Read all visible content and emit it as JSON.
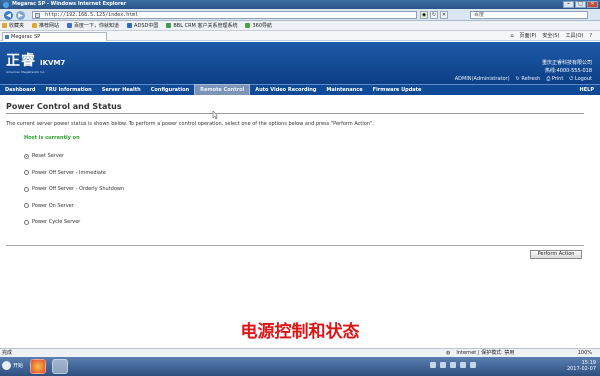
{
  "browser": {
    "title": "Megarac SP - Windows Internet Explorer",
    "url": "http://192.168.5.125/index.html",
    "search_placeholder": "百度",
    "favorites_label": "收藏夹",
    "favorites": [
      "推荐网站",
      "百度一下，你就知道",
      "ADSD中国",
      "BBL CRM 客户关系管理系统",
      "360导航"
    ],
    "tab_label": "Megarac SP",
    "commands": [
      "页面(P)",
      "安全(S)",
      "工具(O)"
    ],
    "status_left": "完成",
    "status_zone": "Internet | 保护模式: 禁用",
    "zoom": "100%"
  },
  "app": {
    "logo": "正睿",
    "logo_sub": "American Megatrends Inc.",
    "product": "IKVM7",
    "company_name": "重庆正睿科技有限公司",
    "hotline": "热线:4000-555-018",
    "user_label": "ADMIN(Administrator)",
    "refresh": "Refresh",
    "print": "Print",
    "logout": "Logout"
  },
  "menu": {
    "items": [
      "Dashboard",
      "FRU Information",
      "Server Health",
      "Configuration",
      "Remote Control",
      "Auto Video Recording",
      "Maintenance",
      "Firmware Update"
    ],
    "active_index": 4,
    "help": "HELP"
  },
  "page": {
    "title": "Power Control and Status",
    "description": "The current server power status is shown below. To perform a power control operation, select one of the options below and press \"Perform Action\".",
    "host_status": "Host is currently on",
    "options": [
      "Reset Server",
      "Power Off Server - Immediate",
      "Power Off Server - Orderly Shutdown",
      "Power On Server",
      "Power Cycle Server"
    ],
    "selected_option": 0,
    "perform_button": "Perform Action",
    "caption": "电源控制和状态"
  },
  "taskbar": {
    "start_label": "开始",
    "time": "15:19",
    "date": "2017-02-07"
  }
}
